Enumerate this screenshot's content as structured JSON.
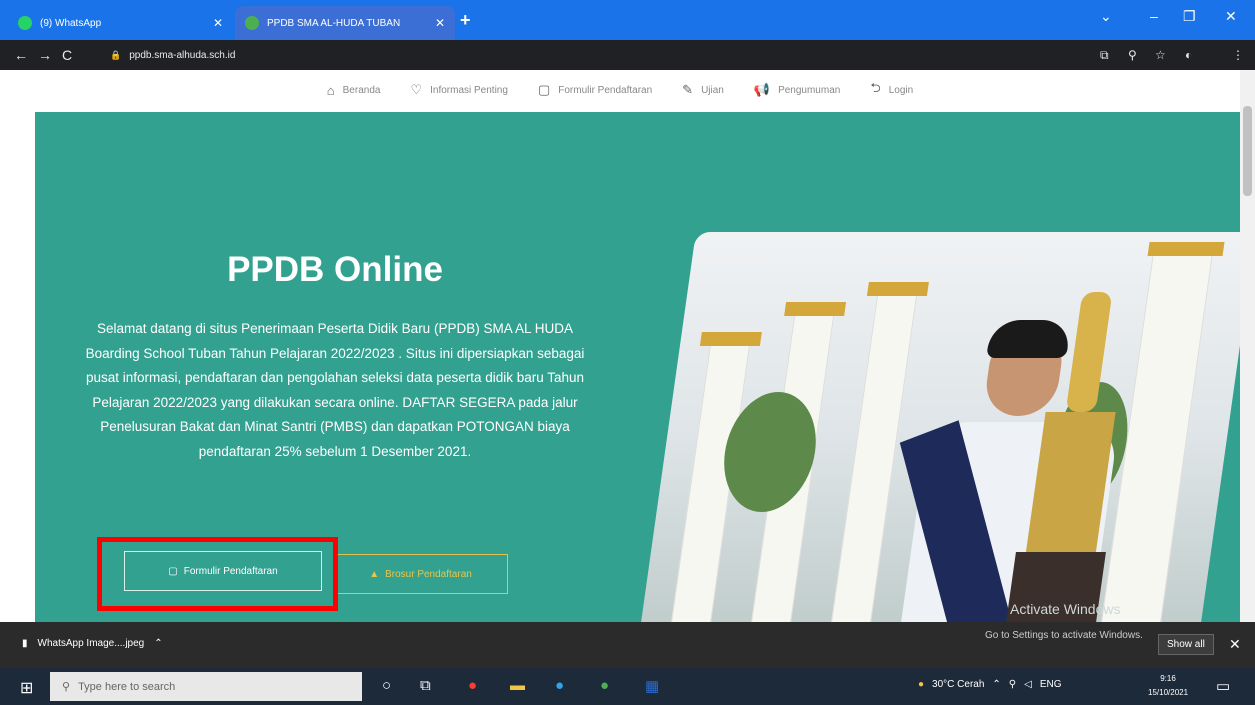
{
  "browser": {
    "tabs": [
      {
        "label": "(9) WhatsApp",
        "icon_color": "#25d366"
      },
      {
        "label": "PPDB SMA AL-HUDA TUBAN",
        "icon_color": "#4caf50"
      }
    ],
    "url": "ppdb.sma-alhuda.sch.id"
  },
  "nav": {
    "items": [
      {
        "label": "Beranda",
        "icon": "home-icon",
        "glyph": "⌂"
      },
      {
        "label": "Informasi Penting",
        "icon": "heart-icon",
        "glyph": "♡"
      },
      {
        "label": "Formulir Pendaftaran",
        "icon": "form-icon",
        "glyph": "▢"
      },
      {
        "label": "Ujian",
        "icon": "edit-icon",
        "glyph": "✎"
      },
      {
        "label": "Pengumuman",
        "icon": "megaphone-icon",
        "glyph": "📢"
      },
      {
        "label": "Login",
        "icon": "login-icon",
        "glyph": "⮌"
      }
    ]
  },
  "hero": {
    "title": "PPDB Online",
    "paragraph": "Selamat datang di situs Penerimaan Peserta Didik Baru (PPDB) SMA AL HUDA Boarding School Tuban Tahun Pelajaran 2022/2023 . Situs ini dipersiapkan sebagai pusat informasi, pendaftaran dan pengolahan seleksi data peserta didik baru Tahun Pelajaran 2022/2023 yang dilakukan secara online. DAFTAR SEGERA pada jalur Penelusuran Bakat dan Minat Santri (PMBS) dan dapatkan POTONGAN biaya pendaftaran 25% sebelum 1 Desember 2021.",
    "button_primary": "Formulir Pendaftaran",
    "button_secondary": "Brosur Pendaftaran",
    "background_color": "#33a190"
  },
  "windows_notice": {
    "title": "Activate Windows",
    "text": "Go to Settings to activate Windows."
  },
  "download_bar": {
    "file_name": "WhatsApp Image....jpeg",
    "show_all": "Show all"
  },
  "taskbar": {
    "search_placeholder": "Type here to search",
    "weather": "30°C  Cerah",
    "language": "ENG",
    "time": "9:16",
    "date": "15/10/2021"
  },
  "highlight_color": "#ff0000"
}
